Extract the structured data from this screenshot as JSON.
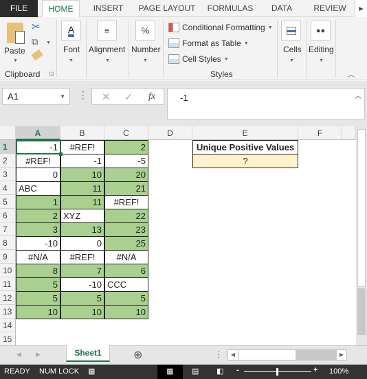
{
  "ribbon": {
    "tabs": [
      "FILE",
      "HOME",
      "INSERT",
      "PAGE LAYOUT",
      "FORMULAS",
      "DATA",
      "REVIEW"
    ],
    "active_tab": "HOME",
    "clipboard": {
      "paste": "Paste",
      "group": "Clipboard"
    },
    "font": "Font",
    "alignment": "Alignment",
    "number": "Number",
    "styles": {
      "conditional": "Conditional Formatting",
      "format_table": "Format as Table",
      "cell_styles": "Cell Styles",
      "group": "Styles"
    },
    "cells": "Cells",
    "editing": "Editing"
  },
  "formula_bar": {
    "name_box": "A1",
    "formula": "-1",
    "fx": "fx"
  },
  "columns": [
    "A",
    "B",
    "C",
    "D",
    "E",
    "F"
  ],
  "rows": [
    "1",
    "2",
    "3",
    "4",
    "5",
    "6",
    "7",
    "8",
    "9",
    "10",
    "11",
    "12",
    "13",
    "14",
    "15"
  ],
  "colors": {
    "highlight": "#a9d08e",
    "result_fill": "#fff2cc",
    "accent": "#217346"
  },
  "table": [
    [
      [
        "-1",
        "r",
        0
      ],
      [
        "#REF!",
        "c",
        0
      ],
      [
        "2",
        "r",
        1
      ]
    ],
    [
      [
        "#REF!",
        "c",
        0
      ],
      [
        "-1",
        "r",
        0
      ],
      [
        "-5",
        "r",
        0
      ]
    ],
    [
      [
        "0",
        "r",
        0
      ],
      [
        "10",
        "r",
        1
      ],
      [
        "20",
        "r",
        1
      ]
    ],
    [
      [
        "ABC",
        "l",
        0
      ],
      [
        "11",
        "r",
        1
      ],
      [
        "21",
        "r",
        1
      ]
    ],
    [
      [
        "1",
        "r",
        1
      ],
      [
        "11",
        "r",
        1
      ],
      [
        "#REF!",
        "c",
        0
      ]
    ],
    [
      [
        "2",
        "r",
        1
      ],
      [
        "XYZ",
        "l",
        0
      ],
      [
        "22",
        "r",
        1
      ]
    ],
    [
      [
        "3",
        "r",
        1
      ],
      [
        "13",
        "r",
        1
      ],
      [
        "23",
        "r",
        1
      ]
    ],
    [
      [
        "-10",
        "r",
        0
      ],
      [
        "0",
        "r",
        0
      ],
      [
        "25",
        "r",
        1
      ]
    ],
    [
      [
        "#N/A",
        "c",
        0
      ],
      [
        "#REF!",
        "c",
        0
      ],
      [
        "#N/A",
        "c",
        0
      ]
    ],
    [
      [
        "8",
        "r",
        1
      ],
      [
        "7",
        "r",
        1
      ],
      [
        "6",
        "r",
        1
      ]
    ],
    [
      [
        "5",
        "r",
        1
      ],
      [
        "-10",
        "r",
        0
      ],
      [
        "CCC",
        "l",
        0
      ]
    ],
    [
      [
        "5",
        "r",
        1
      ],
      [
        "5",
        "r",
        1
      ],
      [
        "5",
        "r",
        1
      ]
    ],
    [
      [
        "10",
        "r",
        1
      ],
      [
        "10",
        "r",
        1
      ],
      [
        "10",
        "r",
        1
      ]
    ]
  ],
  "result": {
    "header": "Unique Positive Values",
    "value": "?"
  },
  "sheet_tab": "Sheet1",
  "status": {
    "ready": "READY",
    "numlock": "NUM LOCK",
    "zoom": "100%",
    "zoom_level": 100
  }
}
